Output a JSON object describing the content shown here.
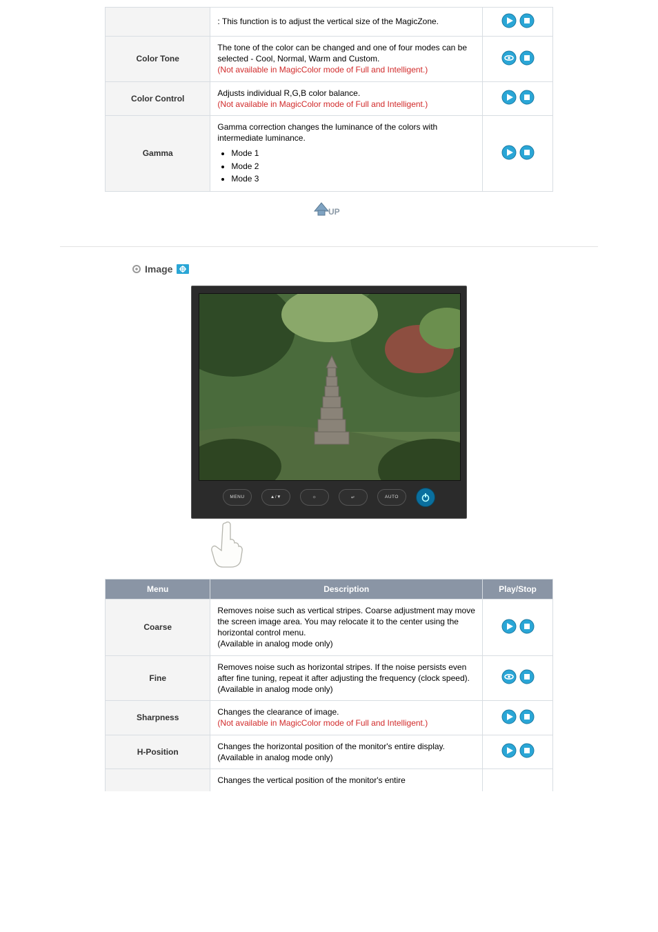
{
  "table1": {
    "rows": [
      {
        "menu": "",
        "desc_main": ": This function is to adjust the vertical size of the MagicZone.",
        "note": "",
        "controls": "play-stop"
      },
      {
        "menu": "Color Tone",
        "desc_main": "The tone of the color can be changed and one of four modes can be selected - Cool, Normal, Warm and Custom.",
        "note": "(Not available in MagicColor mode of Full and Intelligent.)",
        "controls": "eye-stop"
      },
      {
        "menu": "Color Control",
        "desc_main": "Adjusts individual R,G,B color balance.",
        "note": "(Not available in MagicColor mode of Full and Intelligent.)",
        "controls": "play-stop"
      },
      {
        "menu": "Gamma",
        "desc_main": "Gamma correction changes the luminance of the colors with intermediate luminance.",
        "bullets": [
          "Mode 1",
          "Mode 2",
          "Mode 3"
        ],
        "controls": "play-stop"
      }
    ]
  },
  "section_heading": "Image",
  "table2": {
    "headers": {
      "menu": "Menu",
      "desc": "Description",
      "ps": "Play/Stop"
    },
    "rows": [
      {
        "menu": "Coarse",
        "desc_main": "Removes noise such as vertical stripes. Coarse adjustment may move the screen image area. You may relocate it to the center using the horizontal control menu.",
        "tail": "(Available in analog mode only)",
        "controls": "play-stop"
      },
      {
        "menu": "Fine",
        "desc_main": "Removes noise such as horizontal stripes. If the noise persists even after fine tuning, repeat it after adjusting the frequency (clock speed).",
        "tail": "(Available in analog mode only)",
        "controls": "eye-stop"
      },
      {
        "menu": "Sharpness",
        "desc_main": "Changes the clearance of image.",
        "note": "(Not available in MagicColor mode of Full and Intelligent.)",
        "controls": "play-stop"
      },
      {
        "menu": "H-Position",
        "desc_main": "Changes the horizontal position of the monitor's entire display.",
        "tail": "(Available in analog mode only)",
        "controls": "play-stop"
      },
      {
        "menu": "",
        "desc_main": "Changes the vertical position of the monitor's entire",
        "controls": "none"
      }
    ]
  },
  "monitor_buttons": {
    "menu": "MENU",
    "updown": "▲/▼",
    "bright": "☼",
    "enter": "↵",
    "auto": "AUTO"
  },
  "up_label": "UP"
}
